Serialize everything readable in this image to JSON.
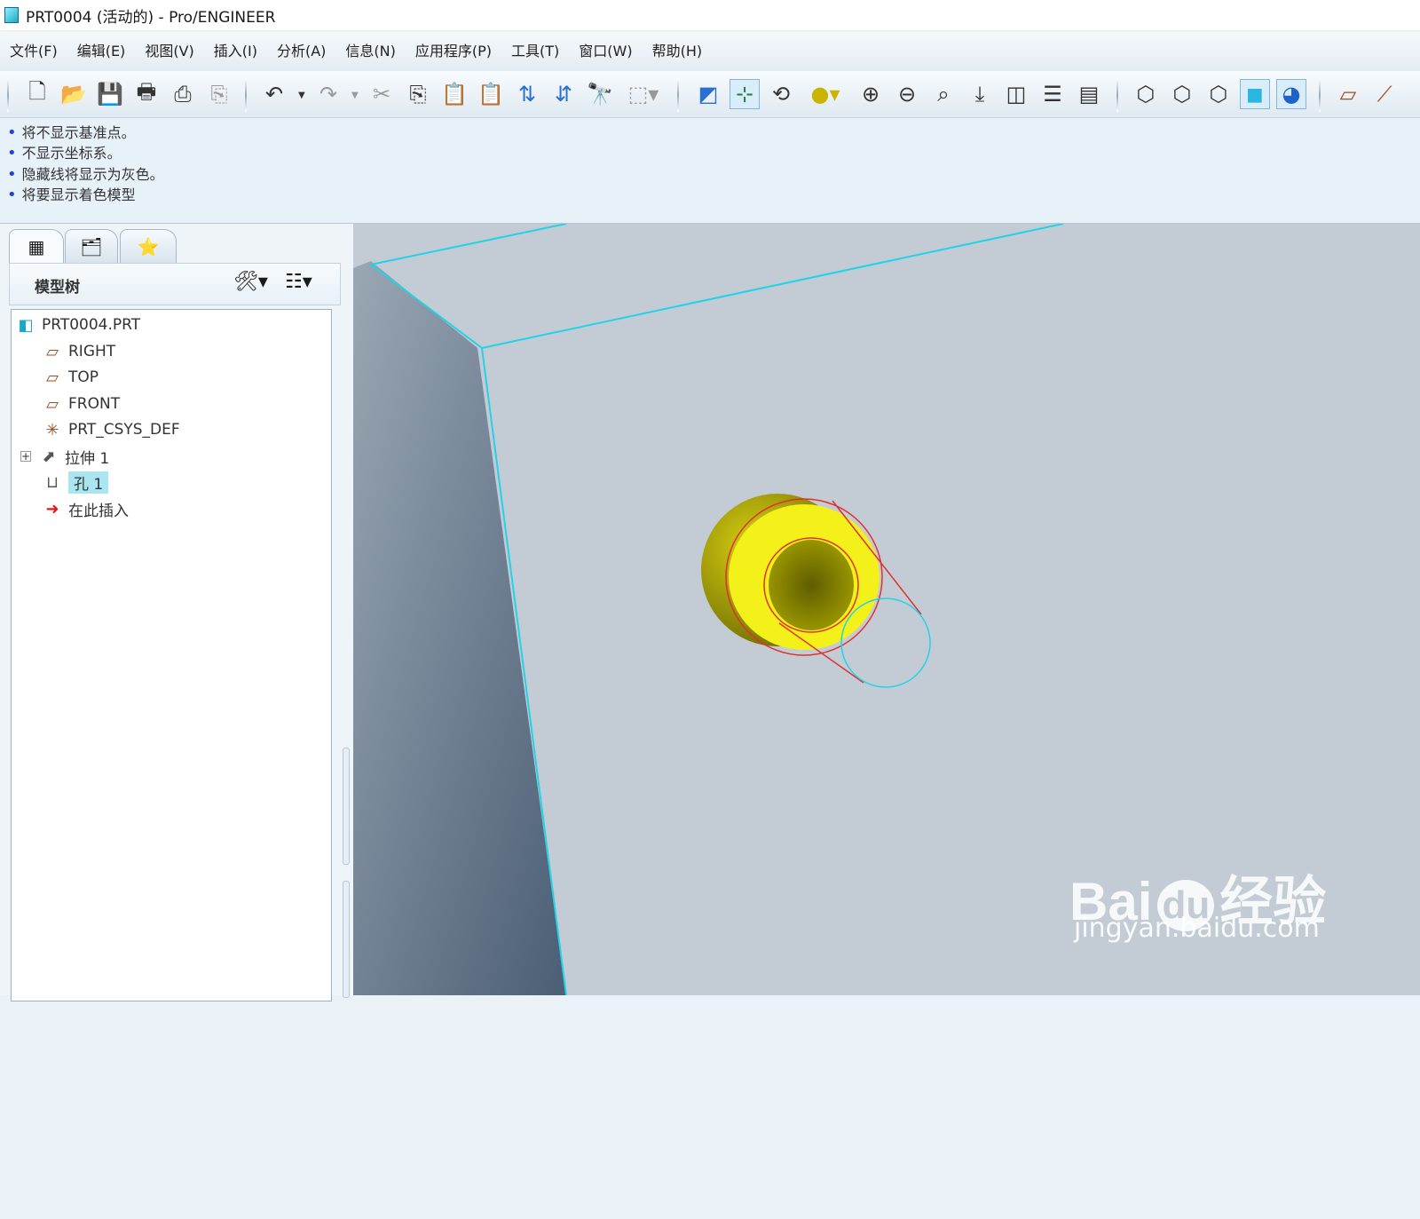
{
  "window": {
    "title": "PRT0004 (活动的) - Pro/ENGINEER"
  },
  "menu": [
    "文件(F)",
    "编辑(E)",
    "视图(V)",
    "插入(I)",
    "分析(A)",
    "信息(N)",
    "应用程序(P)",
    "工具(T)",
    "窗口(W)",
    "帮助(H)"
  ],
  "toolbar": {
    "icons": [
      "new-icon",
      "open-icon",
      "save-icon",
      "print-icon",
      "preview-icon",
      "export-icon",
      "undo-icon",
      "redo-icon",
      "cut-icon",
      "copy-icon",
      "paste-icon",
      "paste-special-icon",
      "regenerate-icon",
      "regen-manager-icon",
      "find-icon",
      "select-box-icon",
      "redraw-icon",
      "spin-center-icon",
      "orient-mode-icon",
      "appearance-icon",
      "zoom-in-icon",
      "zoom-out-icon",
      "refit-icon",
      "reorient-icon",
      "saved-views-icon",
      "layers-icon",
      "view-manager-icon",
      "wireframe-icon",
      "hidden-line-icon",
      "no-hidden-icon",
      "shaded-icon",
      "enhanced-realism-icon",
      "datum-plane-icon",
      "datum-axis-icon"
    ]
  },
  "messages": [
    "将不显示基准点。",
    "不显示坐标系。",
    "隐藏线将显示为灰色。",
    "将要显示着色模型"
  ],
  "panel": {
    "tabs": [
      "model-tree-tab-icon",
      "folder-browser-tab-icon",
      "favorites-tab-icon"
    ],
    "title": "模型树",
    "tree": [
      {
        "label": "PRT0004.PRT",
        "icon": "part-icon"
      },
      {
        "label": "RIGHT",
        "icon": "datum-plane-icon"
      },
      {
        "label": "TOP",
        "icon": "datum-plane-icon"
      },
      {
        "label": "FRONT",
        "icon": "datum-plane-icon"
      },
      {
        "label": "PRT_CSYS_DEF",
        "icon": "csys-icon"
      },
      {
        "label": "拉伸 1",
        "icon": "extrude-icon",
        "expandable": true
      },
      {
        "label": "孔 1",
        "icon": "hole-icon",
        "selected": true
      },
      {
        "label": "在此插入",
        "icon": "insert-here-icon"
      }
    ]
  },
  "watermark": {
    "line1": "Bai",
    "line1b": "du",
    "line1c": "经验",
    "line2": "jingyan.baidu.com"
  },
  "colors": {
    "accent": "#22d3e6",
    "selection": "#e03030",
    "hole": "#f4f01a",
    "hole_dark": "#6d6a00",
    "viewport": "#c3ccd5",
    "message_bullet": "#2143d6"
  }
}
